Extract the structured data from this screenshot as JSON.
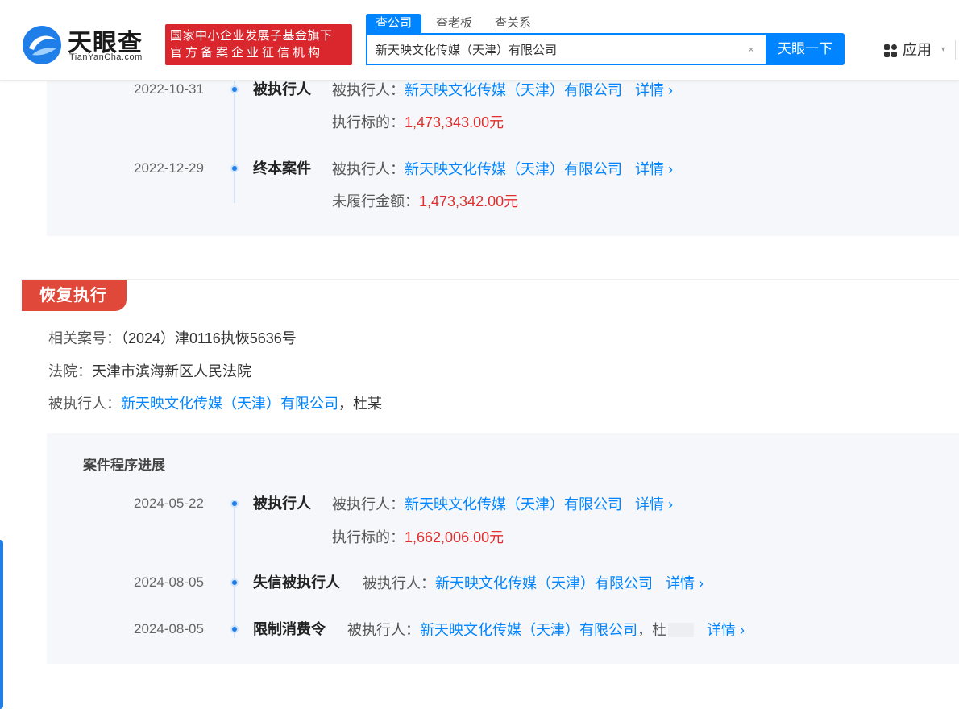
{
  "header": {
    "logo_text": "天眼查",
    "logo_sub": "TianYanCha.com",
    "badge_line1": "国家中小企业发展子基金旗下",
    "badge_line2": "官方备案企业征信机构",
    "tabs": [
      {
        "label": "查公司",
        "active": true
      },
      {
        "label": "查老板",
        "active": false
      },
      {
        "label": "查关系",
        "active": false
      }
    ],
    "search_value": "新天映文化传媒（天津）有限公司",
    "clear_icon": "×",
    "search_button": "天眼一下",
    "apps_label": "应用",
    "apps_caret": "▾"
  },
  "top_timeline": [
    {
      "date": "2022-10-31",
      "type": "被执行人",
      "party_label": "被执行人：",
      "party": "新天映文化传媒（天津）有限公司",
      "detail": "详情",
      "amount_label": "执行标的：",
      "amount": "1,473,343.00元"
    },
    {
      "date": "2022-12-29",
      "type": "终本案件",
      "party_label": "被执行人：",
      "party": "新天映文化传媒（天津）有限公司",
      "detail": "详情",
      "amount_label": "未履行金额：",
      "amount": "1,473,342.00元"
    }
  ],
  "section": {
    "tag": "恢复执行",
    "case_label": "相关案号：",
    "case_value": "（2024）津0116执恢5636号",
    "court_label": "法院：",
    "court_value": "天津市滨海新区人民法院",
    "party_label": "被执行人：",
    "party_company": "新天映文化传媒（天津）有限公司",
    "party_sep": "，",
    "party_person": "杜某",
    "progress_title": "案件程序进展"
  },
  "bottom_timeline": [
    {
      "date": "2024-05-22",
      "type": "被执行人",
      "party_label": "被执行人：",
      "party": "新天映文化传媒（天津）有限公司",
      "detail": "详情",
      "amount_label": "执行标的：",
      "amount": "1,662,006.00元"
    },
    {
      "date": "2024-08-05",
      "type": "失信被执行人",
      "party_label": "被执行人：",
      "party": "新天映文化传媒（天津）有限公司",
      "detail": "详情"
    },
    {
      "date": "2024-08-05",
      "type": "限制消费令",
      "party_label": "被执行人：",
      "party": "新天映文化传媒（天津）有限公司",
      "party_extra": "，杜",
      "detail": "详情"
    }
  ],
  "icons": {
    "chevron": "›"
  },
  "colors": {
    "brand_blue": "#0084ff",
    "badge_red": "#d9272d",
    "tag_red": "#e0493a",
    "amount_red": "#e02d2d"
  }
}
